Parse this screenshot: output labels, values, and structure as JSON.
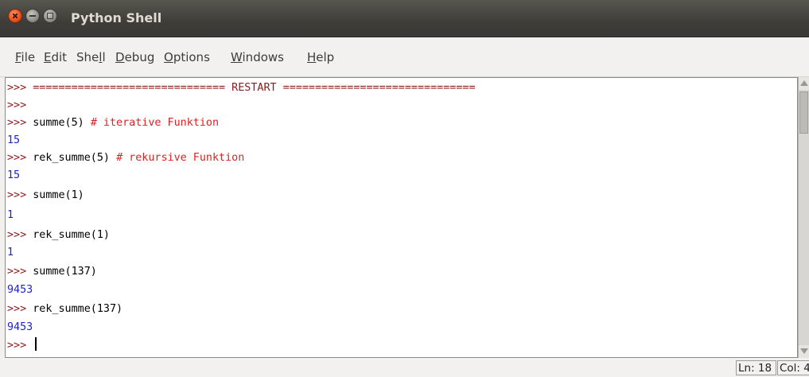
{
  "window": {
    "title": "Python Shell"
  },
  "menubar": {
    "items": [
      {
        "mnemonic": "F",
        "rest": "ile"
      },
      {
        "mnemonic": "E",
        "rest": "dit"
      },
      {
        "pre": "She",
        "mnemonic": "l",
        "rest": "l"
      },
      {
        "mnemonic": "D",
        "rest": "ebug"
      },
      {
        "mnemonic": "O",
        "rest": "ptions"
      },
      {
        "mnemonic": "W",
        "rest": "indows"
      },
      {
        "mnemonic": "H",
        "rest": "elp"
      }
    ]
  },
  "shell": {
    "lines": [
      {
        "prompt": ">>> ",
        "code": "============================== RESTART ==============================",
        "comment": "",
        "output": ""
      },
      {
        "prompt": ">>> ",
        "code": "",
        "comment": "",
        "output": ""
      },
      {
        "prompt": ">>> ",
        "code": "summe(5) ",
        "comment": "# iterative Funktion",
        "output": ""
      },
      {
        "prompt": "",
        "code": "",
        "comment": "",
        "output": "15"
      },
      {
        "prompt": ">>> ",
        "code": "rek_summe(5) ",
        "comment": "# rekursive Funktion",
        "output": ""
      },
      {
        "prompt": "",
        "code": "",
        "comment": "",
        "output": "15"
      },
      {
        "prompt": ">>> ",
        "code": "summe(1)",
        "comment": "",
        "output": ""
      },
      {
        "prompt": "",
        "code": "",
        "comment": "",
        "output": "1"
      },
      {
        "prompt": ">>> ",
        "code": "rek_summe(1)",
        "comment": "",
        "output": ""
      },
      {
        "prompt": "",
        "code": "",
        "comment": "",
        "output": "1"
      },
      {
        "prompt": ">>> ",
        "code": "summe(137)",
        "comment": "",
        "output": ""
      },
      {
        "prompt": "",
        "code": "",
        "comment": "",
        "output": "9453"
      },
      {
        "prompt": ">>> ",
        "code": "rek_summe(137)",
        "comment": "",
        "output": ""
      },
      {
        "prompt": "",
        "code": "",
        "comment": "",
        "output": "9453"
      },
      {
        "prompt": ">>> ",
        "code": "",
        "comment": "",
        "output": "",
        "cursor": true
      }
    ]
  },
  "statusbar": {
    "line": "Ln: 18",
    "col": "Col: 4"
  },
  "colors": {
    "prompt": "#8b1a1a",
    "comment": "#dd2222",
    "output": "#2222cc"
  },
  "icons": [
    "close-icon",
    "minimize-icon",
    "maximize-icon"
  ]
}
